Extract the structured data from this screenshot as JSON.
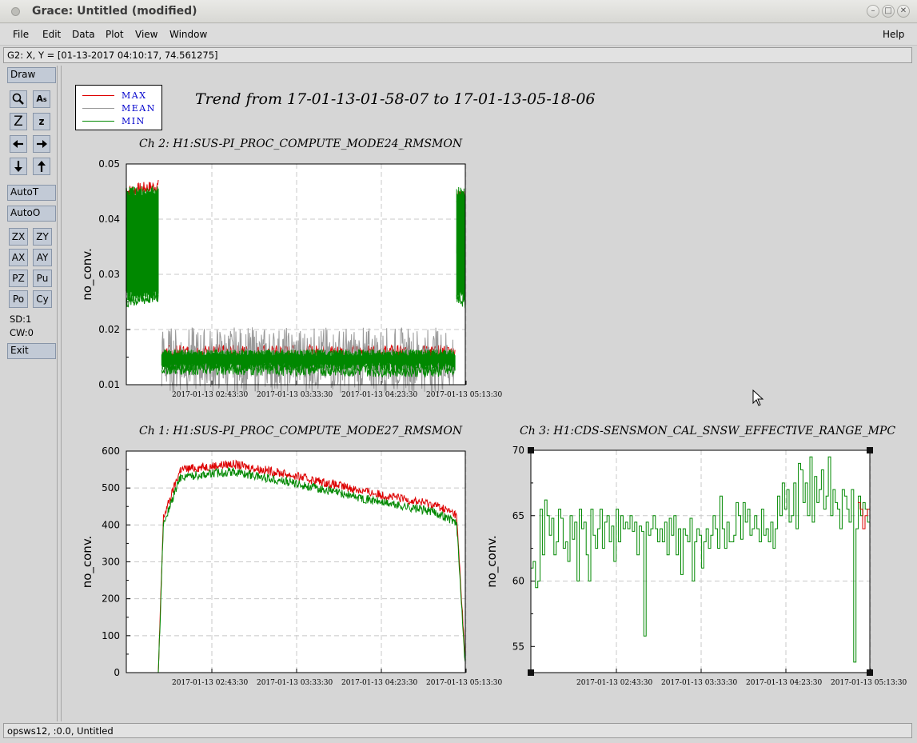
{
  "window": {
    "title": "Grace: Untitled (modified)",
    "minimize": "–",
    "maximize": "□",
    "close": "✕"
  },
  "menubar": {
    "file": "File",
    "edit": "Edit",
    "data": "Data",
    "plot": "Plot",
    "view": "View",
    "window": "Window",
    "help": "Help"
  },
  "locator": {
    "text": "G2: X, Y = [01-13-2017 04:10:17, 74.561275]"
  },
  "toolbar": {
    "draw": "Draw",
    "autot": "AutoT",
    "autoo": "AutoO",
    "zx": "ZX",
    "zy": "ZY",
    "ax": "AX",
    "ay": "AY",
    "pz": "PZ",
    "pu": "Pu",
    "po": "Po",
    "cy": "Cy",
    "sd": "SD:1",
    "cw": "CW:0",
    "exit": "Exit",
    "icons": [
      "zoom-icon",
      "text-icon",
      "zoom-in-icon",
      "zoom-out-icon",
      "left-arrow-icon",
      "right-arrow-icon",
      "down-arrow-icon",
      "up-arrow-icon"
    ],
    "z_big": "Z",
    "z_small": "z",
    "as_label": "A"
  },
  "status": {
    "text": "opsws12, :0.0, Untitled"
  },
  "legend": {
    "max": "MAX",
    "mean": "MEAN",
    "min": "MIN",
    "max_color": "#dd0000",
    "mean_color": "#999999",
    "min_color": "#008800"
  },
  "main_title": "Trend from 17-01-13-01-58-07 to 17-01-13-05-18-06",
  "chart_data": [
    {
      "type": "line",
      "title": "Ch 2: H1:SUS-PI_PROC_COMPUTE_MODE24_RMSMON",
      "ylabel": "no_conv.",
      "ylim": [
        0.01,
        0.05
      ],
      "yticks": [
        "0.05",
        "0.04",
        "0.03",
        "0.02",
        "0.01"
      ],
      "xticks": [
        "2017-01-13 02:43:30",
        "2017-01-13 03:33:30",
        "2017-01-13 04:23:30",
        "2017-01-13 05:13:30"
      ],
      "x_range": [
        "01-13-2017 01:58:07",
        "01-13-2017 05:18:06"
      ],
      "grid": true,
      "series": [
        {
          "name": "MAX",
          "color": "#dd0000",
          "segments": [
            {
              "x": [
                "01:58",
                "02:17"
              ],
              "y": [
                0.045,
                0.046
              ]
            },
            {
              "x": [
                "02:19",
                "05:12"
              ],
              "y": [
                0.016,
                0.016
              ]
            },
            {
              "x": [
                "05:13",
                "05:18"
              ],
              "y": [
                0.044,
                0.045
              ]
            }
          ]
        },
        {
          "name": "MEAN",
          "color": "#999999",
          "segments": [
            {
              "x": [
                "01:58",
                "02:17"
              ],
              "y": [
                0.035,
                0.035
              ]
            },
            {
              "x": [
                "02:19",
                "05:12"
              ],
              "y": [
                0.0145,
                0.0145
              ]
            },
            {
              "x": [
                "05:13",
                "05:18"
              ],
              "y": [
                0.035,
                0.035
              ]
            }
          ]
        },
        {
          "name": "MIN",
          "color": "#008800",
          "segments": [
            {
              "x": [
                "01:58",
                "02:17"
              ],
              "y": [
                0.025,
                0.026
              ]
            },
            {
              "x": [
                "02:19",
                "05:12"
              ],
              "y": [
                0.013,
                0.0125
              ]
            },
            {
              "x": [
                "05:13",
                "05:18"
              ],
              "y": [
                0.026,
                0.025
              ]
            }
          ]
        }
      ]
    },
    {
      "type": "line",
      "title": "Ch 1: H1:SUS-PI_PROC_COMPUTE_MODE27_RMSMON",
      "ylabel": "no_conv.",
      "ylim": [
        0,
        600
      ],
      "yticks": [
        "600",
        "500",
        "400",
        "300",
        "200",
        "100",
        "0"
      ],
      "xticks": [
        "2017-01-13 02:43:30",
        "2017-01-13 03:33:30",
        "2017-01-13 04:23:30",
        "2017-01-13 05:13:30"
      ],
      "grid": true,
      "series": [
        {
          "name": "MAX",
          "color": "#dd0000",
          "x": [
            "01:58",
            "02:10",
            "02:17",
            "02:20",
            "02:30",
            "03:00",
            "03:30",
            "04:00",
            "04:30",
            "05:00",
            "05:12",
            "05:13",
            "05:18"
          ],
          "y": [
            0,
            0,
            0,
            420,
            550,
            565,
            540,
            510,
            480,
            455,
            430,
            420,
            40
          ]
        },
        {
          "name": "MIN",
          "color": "#008800",
          "x": [
            "01:58",
            "02:10",
            "02:17",
            "02:20",
            "02:30",
            "03:00",
            "03:30",
            "04:00",
            "04:30",
            "05:00",
            "05:12",
            "05:13",
            "05:18"
          ],
          "y": [
            0,
            0,
            0,
            400,
            530,
            545,
            520,
            490,
            460,
            435,
            410,
            400,
            30
          ]
        }
      ]
    },
    {
      "type": "line",
      "title": "Ch 3: H1:CDS-SENSMON_CAL_SNSW_EFFECTIVE_RANGE_MPC",
      "ylabel": "no_conv.",
      "ylim": [
        53,
        70
      ],
      "yticks": [
        "70",
        "65",
        "60",
        "55"
      ],
      "xticks": [
        "2017-01-13 02:43:30",
        "2017-01-13 03:33:30",
        "2017-01-13 04:23:30",
        "2017-01-13 05:13:30"
      ],
      "grid": true,
      "series": [
        {
          "name": "MIN",
          "color": "#008800",
          "y": [
            61.0,
            61.5,
            59.5,
            60.0,
            65.5,
            62.0,
            66.2,
            65.0,
            63.5,
            64.8,
            62.0,
            63.0,
            65.5,
            64.8,
            62.5,
            63.0,
            61.5,
            65.0,
            63.2,
            64.5,
            60.0,
            65.5,
            64.0,
            64.5,
            62.0,
            60.0,
            65.5,
            63.5,
            62.5,
            64.0,
            65.5,
            62.5,
            64.5,
            65.0,
            63.0,
            64.2,
            61.5,
            65.5,
            63.0,
            65.0,
            64.0,
            64.5,
            64.0,
            65.0,
            63.8,
            64.5,
            62.0,
            64.2,
            63.8,
            55.8,
            64.5,
            63.5,
            64.0,
            65.0,
            64.0,
            63.0,
            64.0,
            63.0,
            64.5,
            62.0,
            64.8,
            63.5,
            65.0,
            62.0,
            64.0,
            60.5,
            64.0,
            63.5,
            63.0,
            64.8,
            60.0,
            63.0,
            64.0,
            63.5,
            61.0,
            63.0,
            64.0,
            62.5,
            63.5,
            65.0,
            64.0,
            62.5,
            66.5,
            64.0,
            62.5,
            64.5,
            63.0,
            63.0,
            63.5,
            66.0,
            65.0,
            63.2,
            66.0,
            64.5,
            65.5,
            63.5,
            64.0,
            65.0,
            64.0,
            63.0,
            65.5,
            63.5,
            64.0,
            63.0,
            64.5,
            62.5,
            64.0,
            66.5,
            65.0,
            67.5,
            65.5,
            67.0,
            64.5,
            65.0,
            67.5,
            64.0,
            69.0,
            68.5,
            66.0,
            67.5,
            65.0,
            69.5,
            64.5,
            68.0,
            66.0,
            67.0,
            68.5,
            65.5,
            66.5,
            69.5,
            65.0,
            67.0,
            66.0,
            65.5,
            64.0,
            67.0,
            66.5,
            65.5,
            64.5,
            67.0,
            53.8,
            64.0,
            66.5,
            65.0,
            66.0,
            65.5,
            64.5
          ]
        },
        {
          "name": "MAX",
          "color": "#dd0000",
          "y": [
            66.0,
            65.5,
            64.0,
            65.0,
            65.5
          ]
        }
      ]
    }
  ]
}
